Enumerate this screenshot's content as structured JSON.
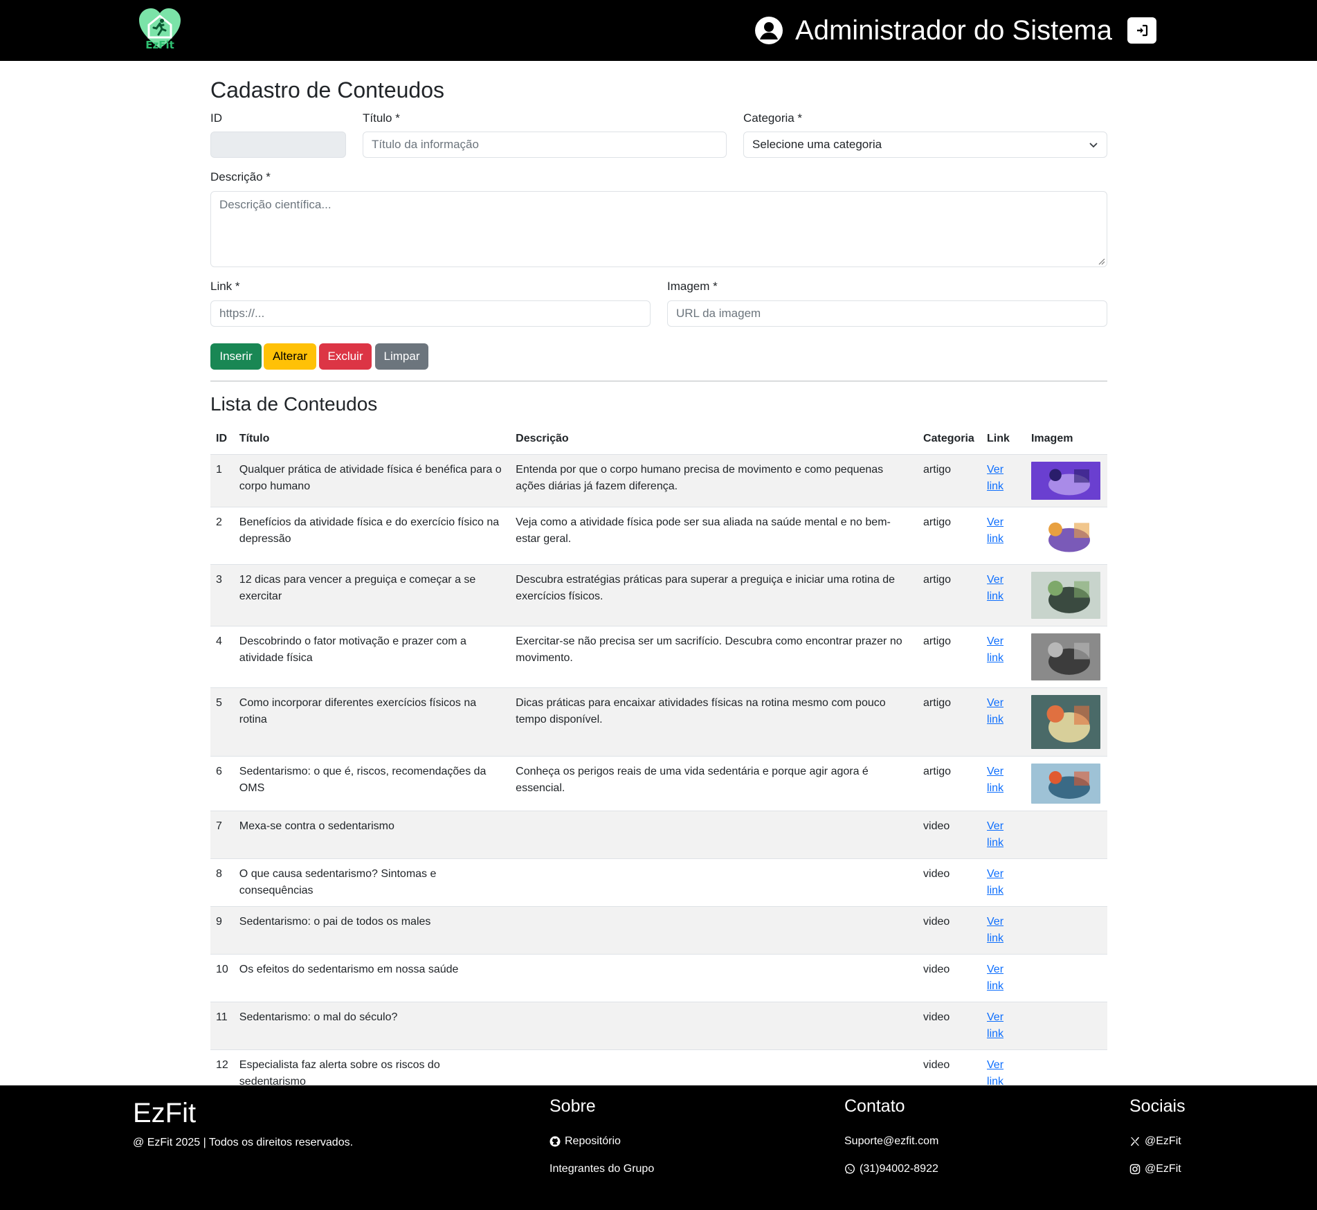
{
  "header": {
    "brand_text": "EzFit",
    "user_name": "Administrador do Sistema"
  },
  "form": {
    "title": "Cadastro de Conteudos",
    "id_label": "ID",
    "titulo_label": "Título *",
    "titulo_placeholder": "Título da informação",
    "categoria_label": "Categoria *",
    "categoria_value": "Selecione uma categoria",
    "descricao_label": "Descrição *",
    "descricao_placeholder": "Descrição científica...",
    "link_label": "Link *",
    "link_placeholder": "https://...",
    "imagem_label": "Imagem *",
    "imagem_placeholder": "URL da imagem",
    "buttons": {
      "inserir": "Inserir",
      "alterar": "Alterar",
      "excluir": "Excluir",
      "limpar": "Limpar"
    }
  },
  "list": {
    "title": "Lista de Conteudos",
    "columns": [
      "ID",
      "Título",
      "Descrição",
      "Categoria",
      "Link",
      "Imagem"
    ],
    "rows": [
      {
        "id": "1",
        "titulo": "Qualquer prática de atividade física é benéfica para o corpo humano",
        "descricao": "Entenda por que o corpo humano precisa de movimento e como pequenas ações diárias já fazem diferença.",
        "categoria": "artigo",
        "link": "Ver link",
        "img": {
          "colors": [
            "#6a3fd0",
            "#a98be8",
            "#2a1d6b"
          ],
          "h": 55
        }
      },
      {
        "id": "2",
        "titulo": "Benefícios da atividade física e do exercício físico na depressão",
        "descricao": "Veja como a atividade física pode ser sua aliada na saúde mental e no bem-estar geral.",
        "categoria": "artigo",
        "link": "Ver link",
        "img": {
          "colors": [
            "#ffffff",
            "#7a5ab8",
            "#e8a040"
          ],
          "h": 62
        }
      },
      {
        "id": "3",
        "titulo": "12 dicas para vencer a preguiça e começar a se exercitar",
        "descricao": "Descubra estratégias práticas para superar a preguiça e iniciar uma rotina de exercícios físicos.",
        "categoria": "artigo",
        "link": "Ver link",
        "img": {
          "colors": [
            "#c8d4cc",
            "#3a4a40",
            "#7ea86a"
          ],
          "h": 68
        }
      },
      {
        "id": "4",
        "titulo": "Descobrindo o fator motivação e prazer com a atividade física",
        "descricao": "Exercitar-se não precisa ser um sacrifício. Descubra como encontrar prazer no movimento.",
        "categoria": "artigo",
        "link": "Ver link",
        "img": {
          "colors": [
            "#8a8a8a",
            "#3c3c3c",
            "#b8b8b8"
          ],
          "h": 68
        }
      },
      {
        "id": "5",
        "titulo": "Como incorporar diferentes exercícios físicos na rotina",
        "descricao": "Dicas práticas para encaixar atividades físicas na rotina mesmo com pouco tempo disponível.",
        "categoria": "artigo",
        "link": "Ver link",
        "img": {
          "colors": [
            "#4a6a68",
            "#d8cf9a",
            "#e07040"
          ],
          "h": 78
        }
      },
      {
        "id": "6",
        "titulo": "Sedentarismo: o que é, riscos, recomendações da OMS",
        "descricao": "Conheça os perigos reais de uma vida sedentária e porque agir agora é essencial.",
        "categoria": "artigo",
        "link": "Ver link",
        "img": {
          "colors": [
            "#9ec2d6",
            "#3a6a86",
            "#e05a30"
          ],
          "h": 58
        }
      },
      {
        "id": "7",
        "titulo": "Mexa-se contra o sedentarismo",
        "descricao": "",
        "categoria": "video",
        "link": "Ver link",
        "img": null
      },
      {
        "id": "8",
        "titulo": "O que causa sedentarismo? Sintomas e consequências",
        "descricao": "",
        "categoria": "video",
        "link": "Ver link",
        "img": null
      },
      {
        "id": "9",
        "titulo": "Sedentarismo: o pai de todos os males",
        "descricao": "",
        "categoria": "video",
        "link": "Ver link",
        "img": null
      },
      {
        "id": "10",
        "titulo": "Os efeitos do sedentarismo em nossa saúde",
        "descricao": "",
        "categoria": "video",
        "link": "Ver link",
        "img": null
      },
      {
        "id": "11",
        "titulo": "Sedentarismo: o mal do século?",
        "descricao": "",
        "categoria": "video",
        "link": "Ver link",
        "img": null
      },
      {
        "id": "12",
        "titulo": "Especialista faz alerta sobre os riscos do sedentarismo",
        "descricao": "",
        "categoria": "video",
        "link": "Ver link",
        "img": null
      }
    ]
  },
  "footer": {
    "brand": "EzFit",
    "copyright": "@ EzFit 2025 | Todos os direitos reservados.",
    "sobre": {
      "title": "Sobre",
      "items": [
        "Repositório",
        "Integrantes do Grupo"
      ]
    },
    "contato": {
      "title": "Contato",
      "items": [
        "Suporte@ezfit.com",
        "(31)94002-8922"
      ]
    },
    "sociais": {
      "title": "Sociais",
      "items": [
        "@EzFit",
        "@EzFit"
      ]
    }
  },
  "colors": {
    "brand_green": "#2fbf71",
    "success": "#198754",
    "warning": "#ffc107",
    "danger": "#dc3545",
    "secondary": "#6c757d",
    "link": "#0d6efd"
  }
}
